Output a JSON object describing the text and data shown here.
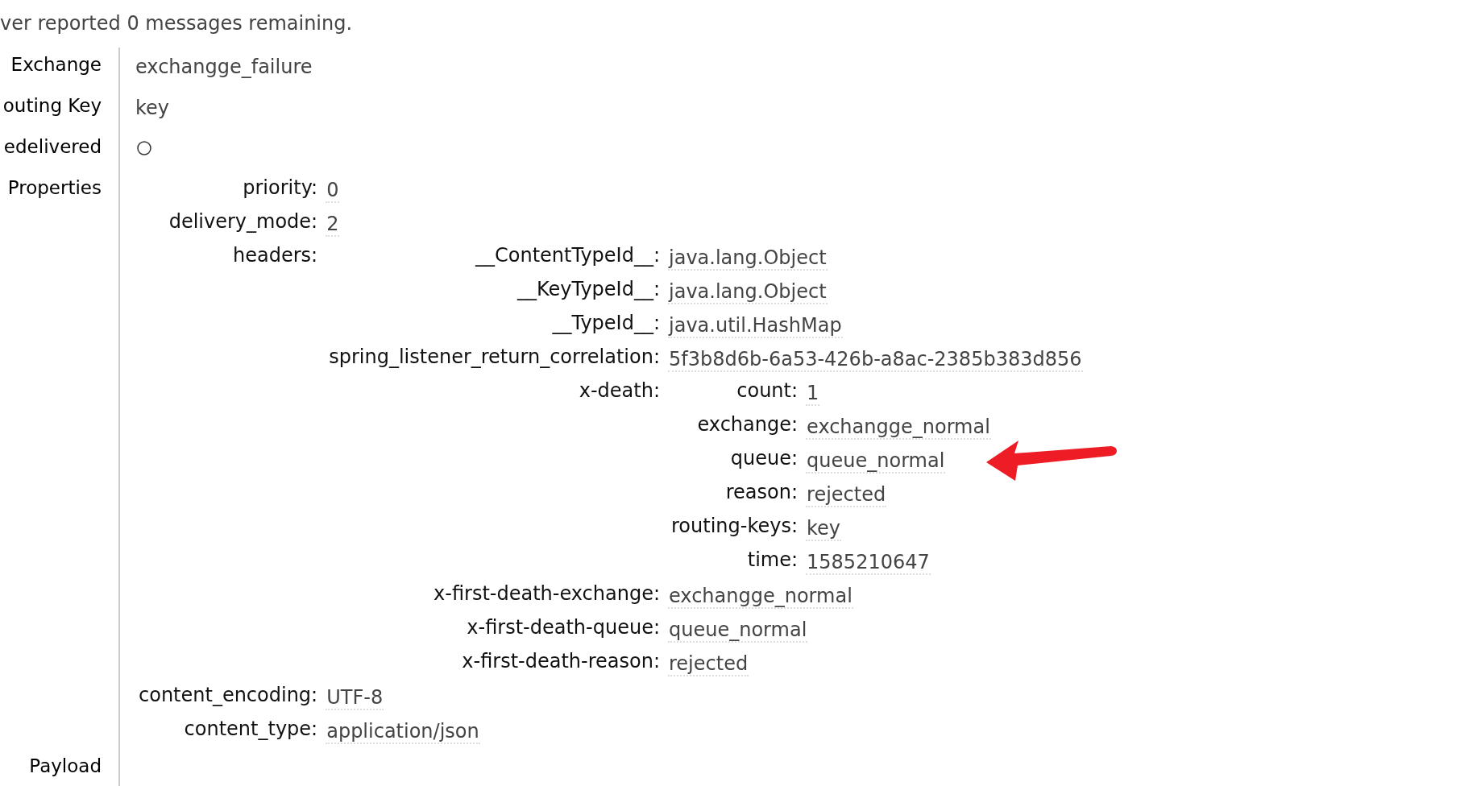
{
  "note": "ver reported 0 messages remaining.",
  "fields": [
    {
      "label": "Exchange",
      "kind": "text",
      "value": "exchangge_failure"
    },
    {
      "label": "outing Key",
      "kind": "text",
      "value": "key"
    },
    {
      "label": "edelivered",
      "kind": "flag",
      "on": false
    },
    {
      "label": "Properties",
      "kind": "table",
      "entries": [
        {
          "key": "priority:",
          "kind": "value",
          "value": "0"
        },
        {
          "key": "delivery_mode:",
          "kind": "value",
          "value": "2"
        },
        {
          "key": "headers:",
          "kind": "group",
          "entries": [
            {
              "key": "__ContentTypeId__:",
              "kind": "value",
              "value": "java.lang.Object"
            },
            {
              "key": "__KeyTypeId__:",
              "kind": "value",
              "value": "java.lang.Object"
            },
            {
              "key": "__TypeId__:",
              "kind": "value",
              "value": "java.util.HashMap"
            },
            {
              "key": "spring_listener_return_correlation:",
              "kind": "value",
              "value": "5f3b8d6b-6a53-426b-a8ac-2385b383d856"
            },
            {
              "key": "x-death:",
              "kind": "group",
              "entries": [
                {
                  "key": "count:",
                  "kind": "value",
                  "value": "1"
                },
                {
                  "key": "exchange:",
                  "kind": "value",
                  "value": "exchangge_normal"
                },
                {
                  "key": "queue:",
                  "kind": "value",
                  "value": "queue_normal"
                },
                {
                  "key": "reason:",
                  "kind": "value",
                  "value": "rejected"
                },
                {
                  "key": "routing-keys:",
                  "kind": "value",
                  "value": "key"
                },
                {
                  "key": "time:",
                  "kind": "value",
                  "value": "1585210647"
                }
              ]
            },
            {
              "key": "x-first-death-exchange:",
              "kind": "value",
              "value": "exchangge_normal"
            },
            {
              "key": "x-first-death-queue:",
              "kind": "value",
              "value": "queue_normal"
            },
            {
              "key": "x-first-death-reason:",
              "kind": "value",
              "value": "rejected"
            }
          ]
        },
        {
          "key": "content_encoding:",
          "kind": "value",
          "value": "UTF-8"
        },
        {
          "key": "content_type:",
          "kind": "value",
          "value": "application/json"
        }
      ]
    },
    {
      "label": "Payload",
      "kind": "blank"
    }
  ]
}
